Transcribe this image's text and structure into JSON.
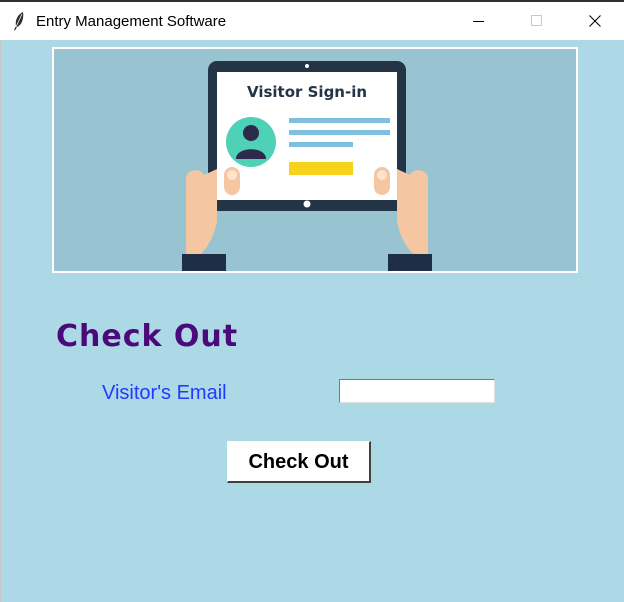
{
  "window": {
    "title": "Entry Management Software",
    "app_icon": "feather-icon",
    "controls": [
      "minimize-icon",
      "maximize-icon",
      "close-icon"
    ]
  },
  "banner": {
    "image": "visitor-sign-in-tablet-illustration",
    "text": "Visitor Sign-in"
  },
  "form": {
    "heading": "Check Out",
    "email_label": "Visitor's Email",
    "email_value": "",
    "submit_label": "Check Out"
  },
  "colors": {
    "background": "#add8e6",
    "heading": "#4b0a7a",
    "label": "#1f3bff",
    "button_bg": "#ffffff"
  }
}
